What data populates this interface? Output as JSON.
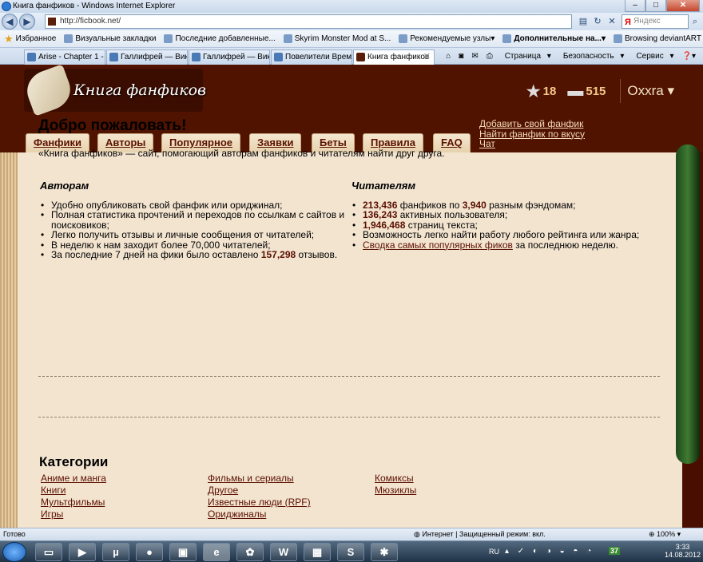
{
  "window": {
    "title": "Книга фанфиков - Windows Internet Explorer"
  },
  "address": {
    "url": "http://ficbook.net/",
    "search_placeholder": "Яндекс"
  },
  "favorites": [
    {
      "label": "Избранное"
    },
    {
      "label": "Визуальные закладки"
    },
    {
      "label": "Последние добавленные..."
    },
    {
      "label": "Skyrim Monster Mod at S..."
    },
    {
      "label": "Рекомендуемые узлы"
    },
    {
      "label": "Дополнительные на..."
    },
    {
      "label": "Browsing deviantART"
    }
  ],
  "tabs": [
    {
      "label": "Arise - Chapter 1 - T..."
    },
    {
      "label": "Галлифрей — Вики..."
    },
    {
      "label": "Галлифрей — Вики ..."
    },
    {
      "label": "Повелители Време..."
    },
    {
      "label": "Книга фанфиков"
    }
  ],
  "commandbar": {
    "page": "Страница",
    "safety": "Безопасность",
    "service": "Сервис"
  },
  "site": {
    "logo_text": "Книга фанфиков",
    "stars_count": "18",
    "messages_count": "515",
    "username": "Oxxra",
    "nav": [
      "Фанфики",
      "Авторы",
      "Популярное",
      "Заявки",
      "Беты",
      "Правила",
      "FAQ"
    ],
    "top_links": [
      "Добавить свой фанфик",
      "Найти фанфик по вкусу",
      "Чат"
    ]
  },
  "welcome": {
    "title": "Добро пожаловать!",
    "intro": "«Книга фанфиков» — сайт, помогающий авторам фанфиков и читателям найти друг друга.",
    "authors_title": "Авторам",
    "authors_items": [
      "Удобно опубликовать свой фанфик или ориджинал;",
      "Полная статистика прочтений и переходов по ссылкам с сайтов и поисковиков;",
      "Легко получить отзывы и личные сообщения от читателей;",
      "В неделю к нам заходит более 70,000 читателей;"
    ],
    "authors_last_prefix": "За последние 7 дней на фики было оставлено ",
    "authors_last_num": "157,298",
    "authors_last_suffix": " отзывов.",
    "readers_title": "Читателям",
    "r1_num": "213,436",
    "r1_mid": " фанфиков по ",
    "r1_num2": "3,940",
    "r1_suffix": " разным фэндомам;",
    "r2_num": "136,243",
    "r2_suffix": " активных пользователя;",
    "r3_num": "1,946,468",
    "r3_suffix": " страниц текста;",
    "r4": "Возможность легко найти работу любого рейтинга или жанра;",
    "r5_link": "Сводка самых популярных фиков",
    "r5_suffix": " за последнюю неделю."
  },
  "categories": {
    "title": "Категории",
    "items": [
      "Аниме и манга",
      "Фильмы и сериалы",
      "Комиксы",
      "Книги",
      "Другое",
      "Мюзиклы",
      "Мультфильмы",
      "Известные люди (RPF)",
      "",
      "Игры",
      "Ориджиналы",
      ""
    ]
  },
  "statusbar": {
    "left": "Готово",
    "zone": "Интернет | Защищенный режим: вкл.",
    "zoom": "100%"
  },
  "taskbar": {
    "lang": "RU",
    "badge": "37",
    "time": "3:33",
    "date": "14.08.2012"
  }
}
